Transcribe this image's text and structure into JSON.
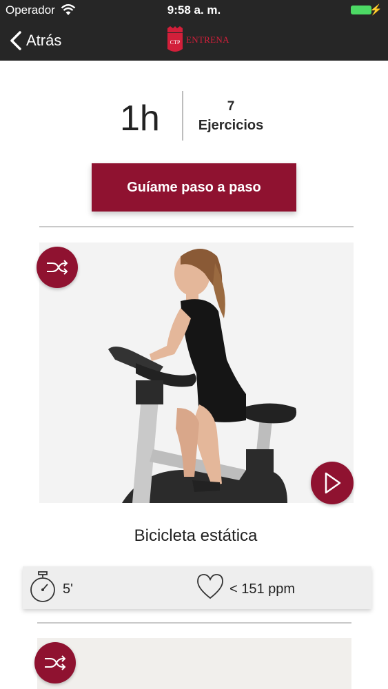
{
  "status_bar": {
    "carrier": "Operador",
    "time": "9:58 a. m.",
    "battery_color": "#4cd964"
  },
  "nav": {
    "back_label": "Atrás",
    "logo_text": "ENTRENA",
    "logo_shield_text": "CTP"
  },
  "summary": {
    "duration": "1h",
    "exercises_count": "7",
    "exercises_label": "Ejercicios"
  },
  "guide_button": {
    "label": "Guíame paso a paso"
  },
  "exercises": [
    {
      "name": "Bicicleta estática",
      "time": "5'",
      "heart_rate": "< 151 ppm",
      "image": "woman-on-stationary-bike"
    },
    {
      "image": "next-exercise-image"
    }
  ],
  "icons": {
    "back": "chevron-left-icon",
    "wifi": "wifi-icon",
    "shuffle": "shuffle-icon",
    "play": "play-icon",
    "timer": "stopwatch-icon",
    "heart": "heart-icon"
  },
  "colors": {
    "accent": "#8f1230",
    "topbar": "#262626",
    "card": "#eeeeee"
  }
}
